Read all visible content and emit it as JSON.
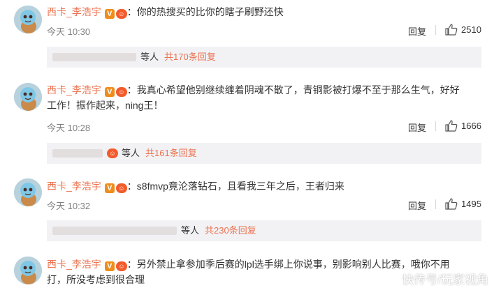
{
  "comments": [
    {
      "username": "西卡_李浩宇",
      "vbadge": "V",
      "text": "：你的热搜买的比你的瞎子刷野还快",
      "time": "今天 10:30",
      "reply_label": "回复",
      "likes": "2510",
      "sub": {
        "who": "等人",
        "more": "共170条回复"
      }
    },
    {
      "username": "西卡_李浩宇",
      "vbadge": "V",
      "text": "：我真心希望他别继续缠着阴魂不散了，青铜影被打爆不至于那么生气，好好",
      "text2": "工作！振作起来，ning王！",
      "time": "今天 10:28",
      "reply_label": "回复",
      "likes": "1666",
      "sub": {
        "who": "等人",
        "more": "共161条回复"
      }
    },
    {
      "username": "西卡_李浩宇",
      "vbadge": "V",
      "text": "：s8fmvp竟沦落钻石，且看我三年之后，王者归来",
      "time": "今天 10:32",
      "reply_label": "回复",
      "likes": "1495",
      "sub": {
        "who": "等人",
        "more": "共230条回复"
      }
    },
    {
      "username": "西卡_李浩宇",
      "vbadge": "V",
      "text": "：另外禁止拿参加季后赛的lpl选手绑上你说事，别影响别人比赛，哦你不用",
      "text2": "打，所没考虑到很合理"
    }
  ],
  "watermark": "快传号/玩家视角",
  "colors": {
    "username": "#eb7350",
    "more": "#eb7350",
    "subbg": "#f2f2f5",
    "vbadge": "#ef8d1c"
  },
  "icons": {
    "avatar": "squirtle-avatar-icon",
    "like": "thumbs-up-icon",
    "medal": "fan-medal-icon"
  }
}
